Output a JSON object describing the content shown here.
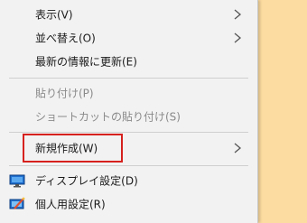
{
  "menu": {
    "items": [
      {
        "label": "表示(V)",
        "submenu": true,
        "enabled": true
      },
      {
        "label": "並べ替え(O)",
        "submenu": true,
        "enabled": true
      },
      {
        "label": "最新の情報に更新(E)",
        "submenu": false,
        "enabled": true
      },
      {
        "label": "貼り付け(P)",
        "submenu": false,
        "enabled": false
      },
      {
        "label": "ショートカットの貼り付け(S)",
        "submenu": false,
        "enabled": false
      },
      {
        "label": "新規作成(W)",
        "submenu": true,
        "enabled": true,
        "highlighted": true
      },
      {
        "label": "ディスプレイ設定(D)",
        "submenu": false,
        "enabled": true,
        "icon": "display-settings-icon"
      },
      {
        "label": "個人用設定(R)",
        "submenu": false,
        "enabled": true,
        "icon": "personalize-icon"
      }
    ]
  },
  "colors": {
    "menu_background": "#f2f2f2",
    "desktop_background": "#fcdca0",
    "highlight_border": "#d6211e",
    "disabled_text": "#8a8a8a"
  }
}
